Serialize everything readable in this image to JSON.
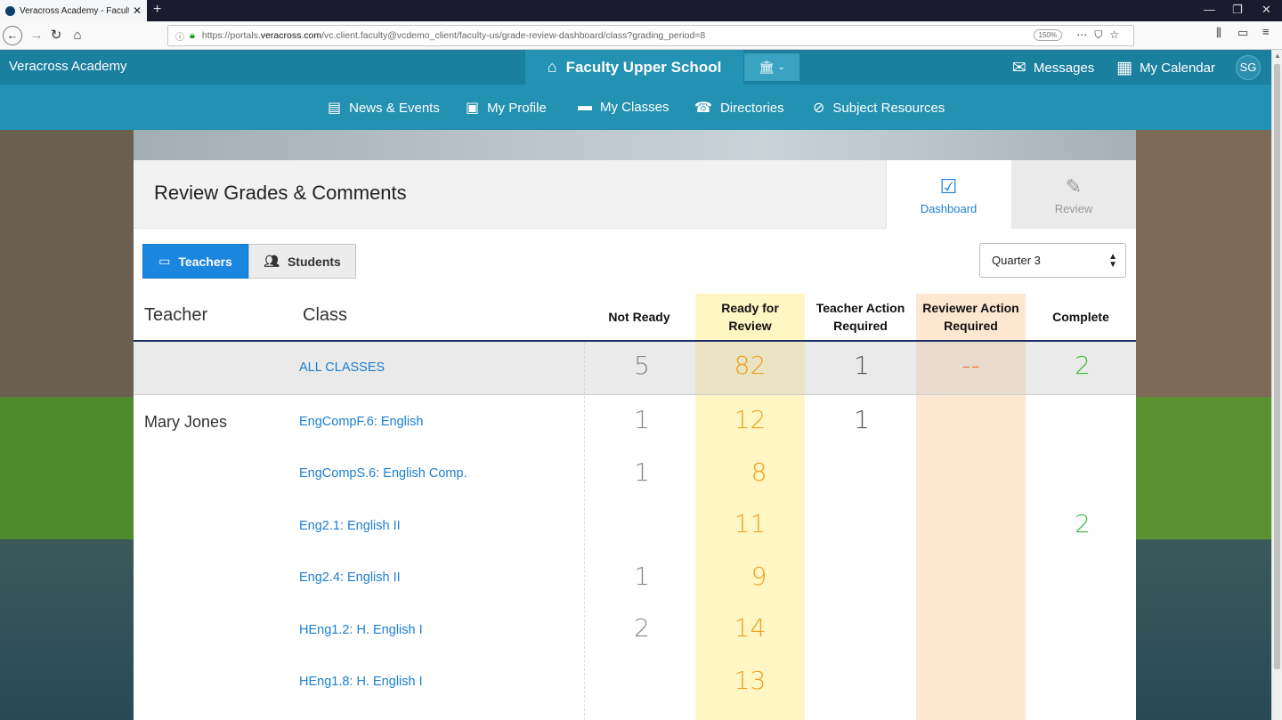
{
  "browser": {
    "tab_title": "Veracross Academy - Faculty U",
    "url_prefix": "https://portals.",
    "url_domain": "veracross.com",
    "url_rest": "/vc.client.faculty@vcdemo_client/faculty-us/grade-review-dashboard/class?grading_period=8",
    "zoom": "150%"
  },
  "header": {
    "brand": "Veracross Academy",
    "portal": "Faculty Upper School",
    "messages": "Messages",
    "calendar": "My Calendar",
    "avatar": "SG"
  },
  "menu": {
    "items": [
      {
        "label": "News & Events",
        "icon": "newspaper-icon"
      },
      {
        "label": "My Profile",
        "icon": "profile-icon"
      },
      {
        "label": "My Classes",
        "icon": "briefcase-icon"
      },
      {
        "label": "Directories",
        "icon": "phone-icon"
      },
      {
        "label": "Subject Resources",
        "icon": "paperclip-icon"
      }
    ]
  },
  "page": {
    "title": "Review Grades & Comments",
    "tabs": {
      "dashboard": "Dashboard",
      "review": "Review"
    },
    "toggle": {
      "teachers": "Teachers",
      "students": "Students"
    },
    "grading_period": "Quarter 3"
  },
  "table": {
    "headers": {
      "teacher": "Teacher",
      "class": "Class",
      "not_ready": "Not Ready",
      "ready_l1": "Ready for",
      "ready_l2": "Review",
      "teacher_l1": "Teacher Action",
      "teacher_l2": "Required",
      "reviewer_l1": "Reviewer Action",
      "reviewer_l2": "Required",
      "complete": "Complete"
    },
    "all": {
      "label": "ALL CLASSES",
      "not_ready": "5",
      "ready": "82",
      "teacher_action": "1",
      "reviewer_action": "--",
      "complete": "2"
    },
    "teacher_name": "Mary Jones",
    "rows": [
      {
        "cls": "EngCompF.6: English",
        "not_ready": "1",
        "ready": "12",
        "teacher_action": "1",
        "complete": ""
      },
      {
        "cls": "EngCompS.6: English Comp.",
        "not_ready": "1",
        "ready": "8",
        "teacher_action": "",
        "complete": ""
      },
      {
        "cls": "Eng2.1: English II",
        "not_ready": "",
        "ready": "11",
        "teacher_action": "",
        "complete": "2"
      },
      {
        "cls": "Eng2.4: English II",
        "not_ready": "1",
        "ready": "9",
        "teacher_action": "",
        "complete": ""
      },
      {
        "cls": "HEng1.2: H. English I",
        "not_ready": "2",
        "ready": "14",
        "teacher_action": "",
        "complete": ""
      },
      {
        "cls": "HEng1.8: H. English I",
        "not_ready": "",
        "ready": "13",
        "teacher_action": "",
        "complete": ""
      }
    ]
  },
  "colors": {
    "header": "#1b7f9e",
    "menu": "#2391b2",
    "accent": "#1a86e0",
    "ready_bg": "#fff6c4",
    "reviewer_bg": "#fde7d0"
  }
}
